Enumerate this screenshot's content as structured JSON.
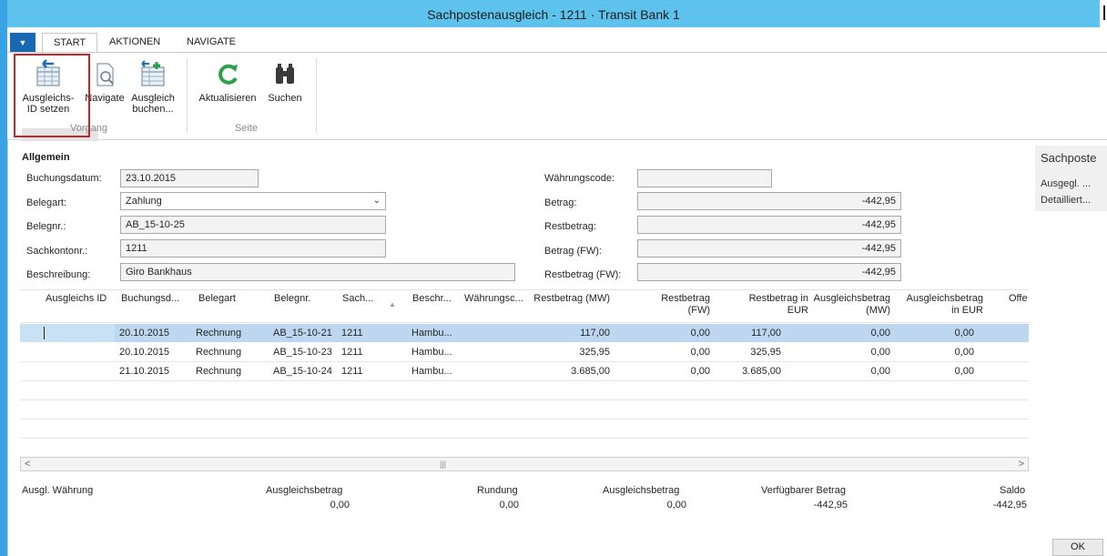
{
  "window": {
    "title": "Sachpostenausgleich - 1211 · Transit Bank 1"
  },
  "tabs": [
    {
      "label": "START"
    },
    {
      "label": "AKTIONEN"
    },
    {
      "label": "NAVIGATE"
    }
  ],
  "ribbon": {
    "buttons": {
      "ausgleichs_id": "Ausgleichs-\nID setzen",
      "navigate": "Navigate",
      "ausgleich_buchen": "Ausgleich\nbuchen...",
      "aktualisieren": "Aktualisieren",
      "suchen": "Suchen"
    },
    "groups": {
      "vorgang": "Vorgang",
      "seite": "Seite"
    }
  },
  "form": {
    "section": "Allgemein",
    "buchungsdatum": {
      "label": "Buchungsdatum:",
      "value": "23.10.2015"
    },
    "belegart": {
      "label": "Belegart:",
      "value": "Zahlung"
    },
    "belegnr": {
      "label": "Belegnr.:",
      "value": "AB_15-10-25"
    },
    "sachkontonr": {
      "label": "Sachkontonr.:",
      "value": "1211"
    },
    "beschreibung": {
      "label": "Beschreibung:",
      "value": "Giro Bankhaus"
    },
    "waehrungscode": {
      "label": "Währungscode:",
      "value": ""
    },
    "betrag": {
      "label": "Betrag:",
      "value": "-442,95"
    },
    "restbetrag": {
      "label": "Restbetrag:",
      "value": "-442,95"
    },
    "betrag_fw": {
      "label": "Betrag (FW):",
      "value": "-442,95"
    },
    "restbetrag_fw": {
      "label": "Restbetrag (FW):",
      "value": "-442,95"
    }
  },
  "grid": {
    "headers": {
      "ausgleichs_id": "Ausgleichs ID",
      "buchungsdatum": "Buchungsd...",
      "belegart": "Belegart",
      "belegnr": "Belegnr.",
      "sach": "Sach...",
      "beschr": "Beschr...",
      "waehrung": "Währungsc...",
      "restbetrag_mw": "Restbetrag (MW)",
      "restbetrag_fw_1": "Restbetrag",
      "restbetrag_fw_2": "(FW)",
      "restbetrag_eur_1": "Restbetrag in",
      "restbetrag_eur_2": "EUR",
      "ausgleich_mw_1": "Ausgleichsbetrag",
      "ausgleich_mw_2": "(MW)",
      "ausgleich_eur_1": "Ausgleichsbetrag",
      "ausgleich_eur_2": "in EUR",
      "offen": "Offe"
    },
    "rows": [
      {
        "datum": "20.10.2015",
        "belegart": "Rechnung",
        "belegnr": "AB_15-10-21",
        "sach": "1211",
        "beschr": "Hambu...",
        "rest_mw": "117,00",
        "rest_fw": "0,00",
        "rest_eur": "117,00",
        "ausgl_mw": "0,00",
        "ausgl_eur": "0,00"
      },
      {
        "datum": "20.10.2015",
        "belegart": "Rechnung",
        "belegnr": "AB_15-10-23",
        "sach": "1211",
        "beschr": "Hambu...",
        "rest_mw": "325,95",
        "rest_fw": "0,00",
        "rest_eur": "325,95",
        "ausgl_mw": "0,00",
        "ausgl_eur": "0,00"
      },
      {
        "datum": "21.10.2015",
        "belegart": "Rechnung",
        "belegnr": "AB_15-10-24",
        "sach": "1211",
        "beschr": "Hambu...",
        "rest_mw": "3.685,00",
        "rest_fw": "0,00",
        "rest_eur": "3.685,00",
        "ausgl_mw": "0,00",
        "ausgl_eur": "0,00"
      }
    ]
  },
  "summary": {
    "ausgl_waehrung": {
      "label": "Ausgl. Währung"
    },
    "ausgleichsbetrag1": {
      "label": "Ausgleichsbetrag",
      "value": "0,00"
    },
    "rundung": {
      "label": "Rundung",
      "value": "0,00"
    },
    "ausgleichsbetrag2": {
      "label": "Ausgleichsbetrag",
      "value": "0,00"
    },
    "verfuegbar": {
      "label": "Verfügbarer Betrag",
      "value": "-442,95"
    },
    "saldo": {
      "label": "Saldo",
      "value": "-442,95"
    }
  },
  "factbox": {
    "title": "Sachposte",
    "line1": "Ausgegl. ...",
    "line2": "Detailliert..."
  },
  "ok_label": "OK",
  "colors": {
    "titlebar": "#5dc2ec",
    "selection": "#c8e1f5",
    "highlight": "#c0252b",
    "accent": "#1769b6"
  }
}
